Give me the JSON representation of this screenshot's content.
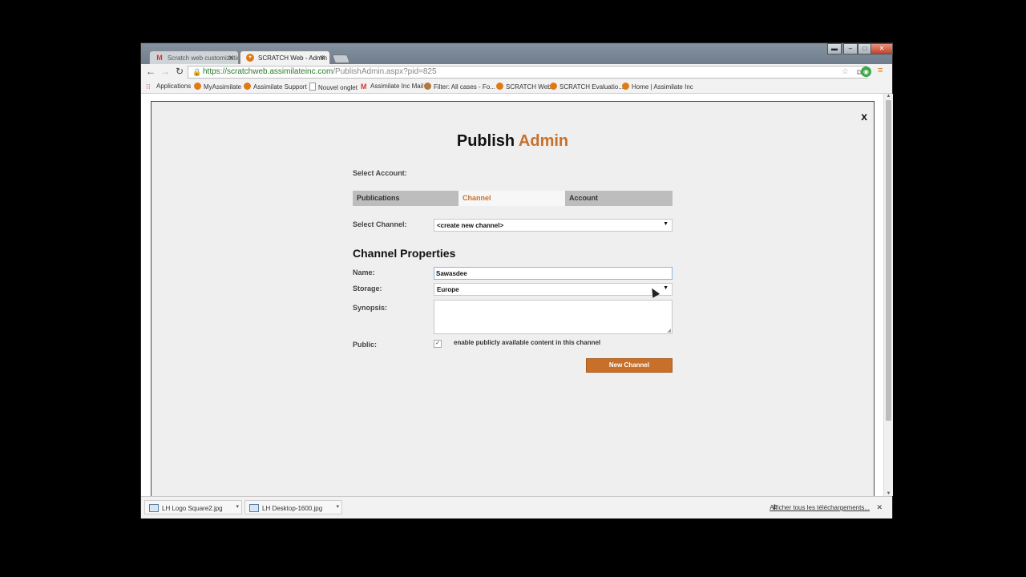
{
  "browser": {
    "tabs": [
      {
        "label": "Scratch web customizatio",
        "icon": "gmail-icon"
      },
      {
        "label": "SCRATCH Web - Admin",
        "icon": "scratch-icon"
      }
    ],
    "url_host": "https://scratchweb.assimilateinc.com",
    "url_path": "/PublishAdmin.aspx?pid=825",
    "bookmarks": [
      "Applications",
      "MyAssimilate",
      "Assimilate Support",
      "Nouvel onglet",
      "Assimilate Inc Mail",
      "Filter: All cases - Fo...",
      "SCRATCH Web",
      "SCRATCH Evaluatio...",
      "Home | Assimilate Inc"
    ]
  },
  "modal": {
    "close_label": "x",
    "title_main": "Publish",
    "title_accent": "Admin",
    "select_account_label": "Select Account:",
    "tabs": [
      "Publications",
      "Channel",
      "Account"
    ],
    "active_tab": "Channel",
    "select_channel_label": "Select Channel:",
    "select_channel_value": "<create new channel>",
    "section_title": "Channel Properties",
    "name_label": "Name:",
    "name_value": "Sawasdee",
    "storage_label": "Storage:",
    "storage_value": "Europe",
    "synopsis_label": "Synopsis:",
    "public_label": "Public:",
    "public_checked": true,
    "public_text": "enable publicly available content in this channel",
    "button_label": "New Channel",
    "accent_color": "#c8702a"
  },
  "downloads": {
    "items": [
      "LH Logo Square2.jpg",
      "LH Desktop-1600.jpg"
    ],
    "show_all": "Afficher tous les téléchargements..."
  }
}
